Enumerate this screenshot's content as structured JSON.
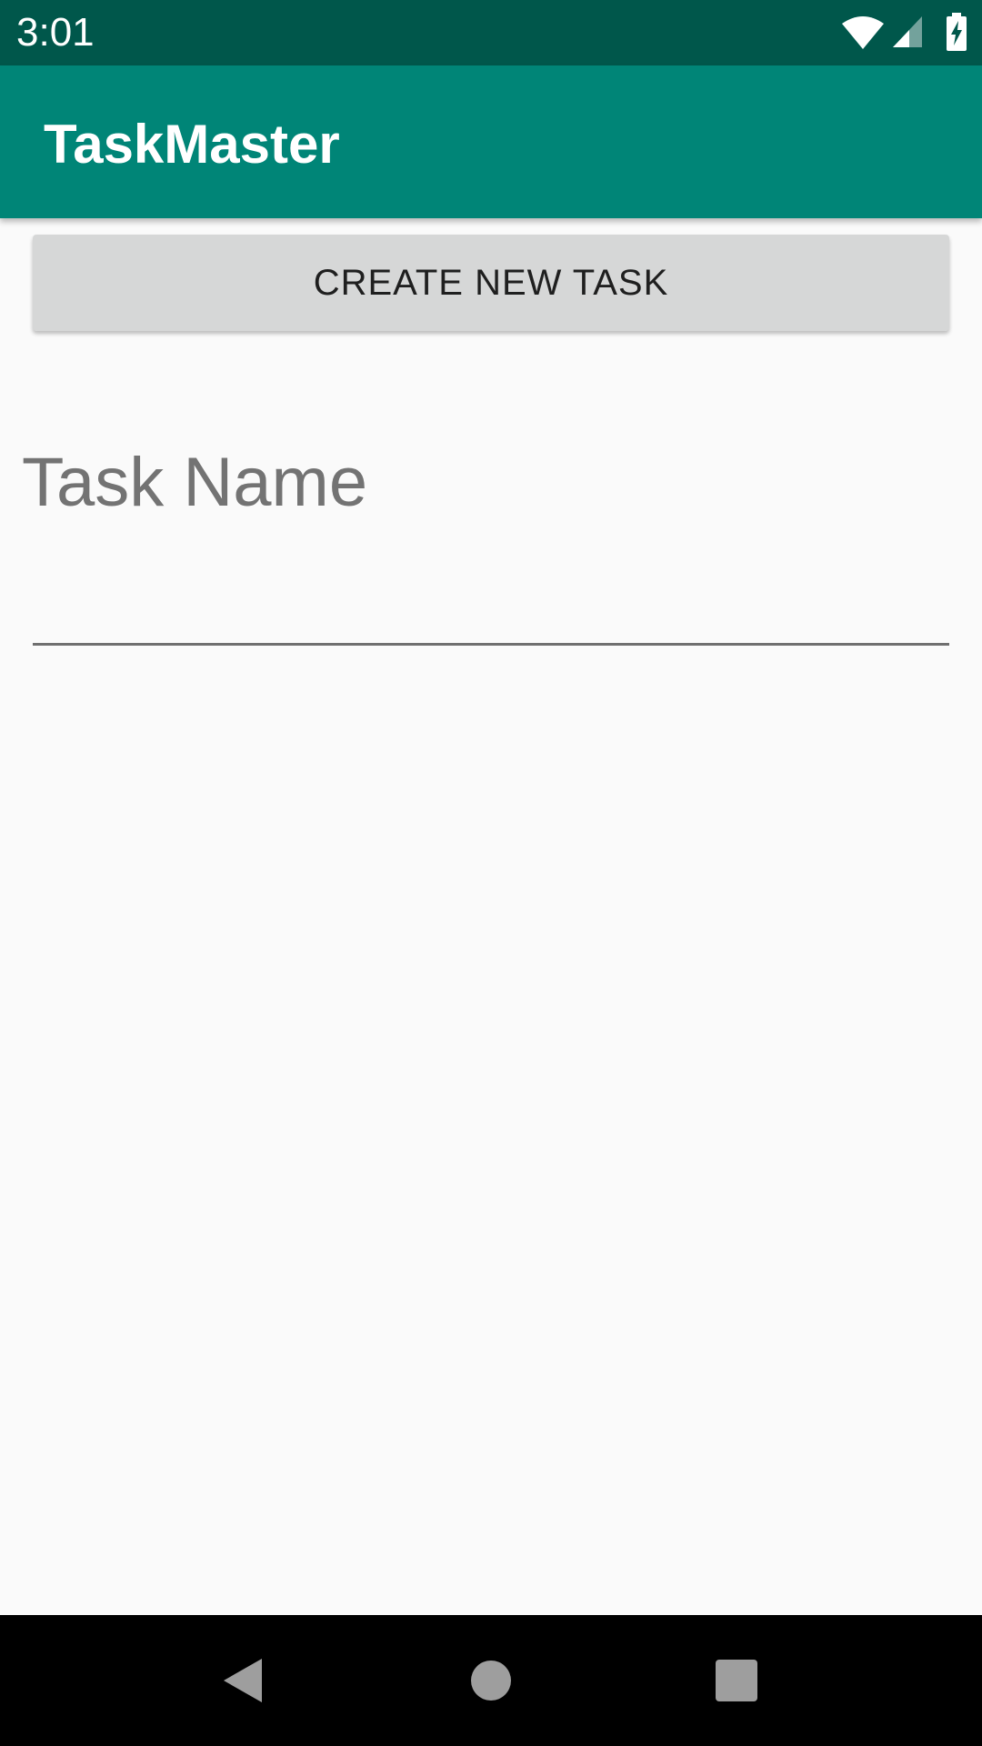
{
  "status_bar": {
    "time": "3:01",
    "icons": [
      "wifi-icon",
      "cell-signal-icon",
      "battery-charging-icon"
    ]
  },
  "app_bar": {
    "title": "TaskMaster",
    "color": "#008577",
    "status_color": "#00574b"
  },
  "main": {
    "create_button_label": "CREATE NEW TASK",
    "task_name_label": "Task Name",
    "task_input_value": "",
    "task_input_placeholder": ""
  },
  "nav_bar": {
    "icons": [
      "back-icon",
      "home-icon",
      "recents-icon"
    ]
  }
}
